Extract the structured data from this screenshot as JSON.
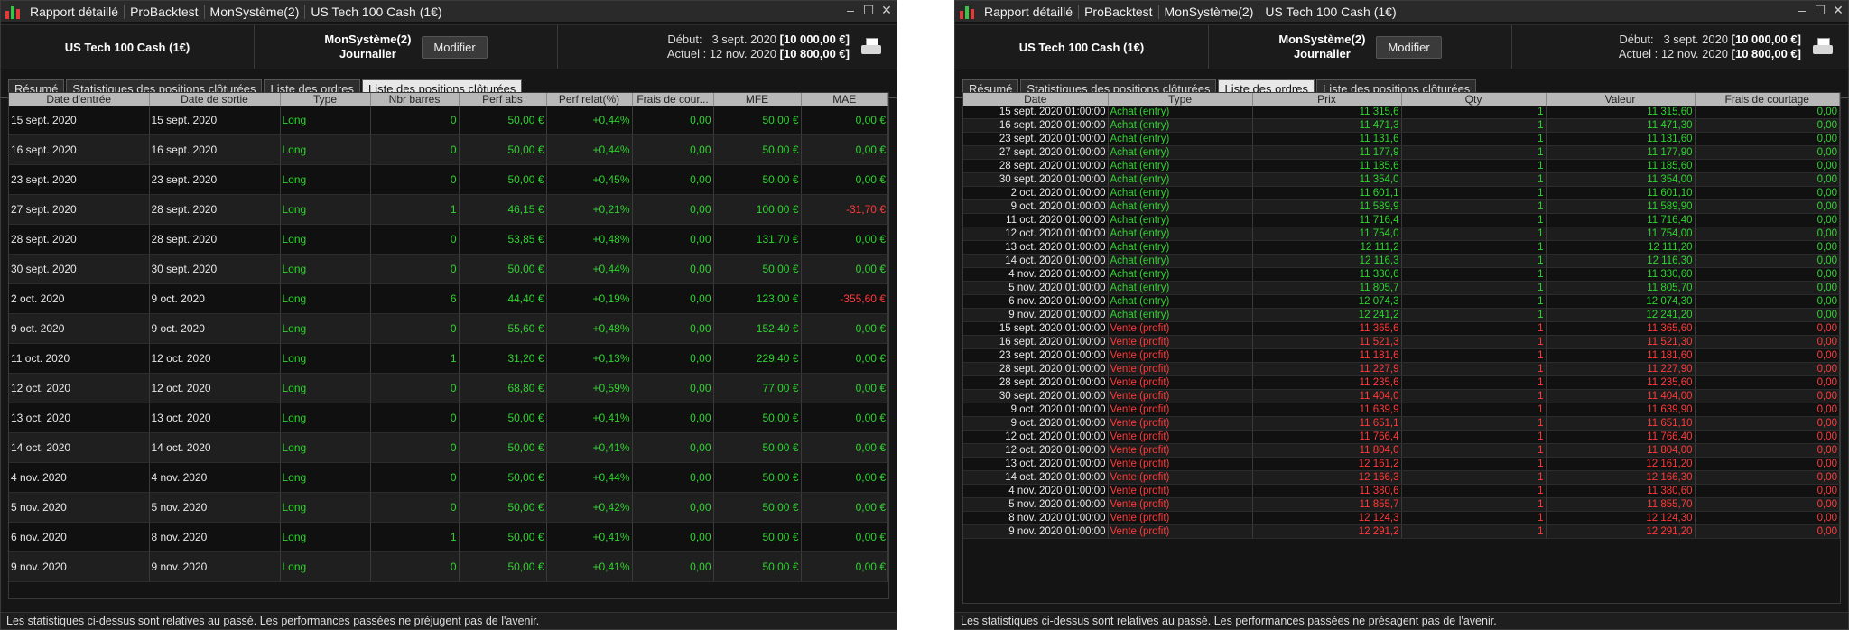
{
  "left": {
    "title_segments": [
      "Rapport détaillé",
      "ProBacktest",
      "MonSystème(2)",
      "US Tech 100 Cash (1€)"
    ],
    "instrument": "US Tech 100 Cash (1€)",
    "system_name": "MonSystème(2)",
    "timeframe": "Journalier",
    "modify_label": "Modifier",
    "start_label": "Début:",
    "start_date": "3 sept. 2020",
    "start_value": "[10 000,00 €]",
    "current_label": "Actuel :",
    "current_date": "12 nov. 2020",
    "current_value": "[10 800,00 €]",
    "tabs": [
      "Résumé",
      "Statistiques des positions clôturées",
      "Liste des ordres",
      "Liste des positions clôturées"
    ],
    "active_tab": 3,
    "columns": [
      "Date d'entrée",
      "Date de sortie",
      "Type",
      "Nbr barres",
      "Perf abs",
      "Perf relat(%)",
      "Frais de cour...",
      "MFE",
      "MAE"
    ],
    "rows": [
      [
        "15 sept. 2020",
        "15 sept. 2020",
        "Long",
        "0",
        "50,00 €",
        "+0,44%",
        "0,00",
        "50,00 €",
        "0,00 €"
      ],
      [
        "16 sept. 2020",
        "16 sept. 2020",
        "Long",
        "0",
        "50,00 €",
        "+0,44%",
        "0,00",
        "50,00 €",
        "0,00 €"
      ],
      [
        "23 sept. 2020",
        "23 sept. 2020",
        "Long",
        "0",
        "50,00 €",
        "+0,45%",
        "0,00",
        "50,00 €",
        "0,00 €"
      ],
      [
        "27 sept. 2020",
        "28 sept. 2020",
        "Long",
        "1",
        "46,15 €",
        "+0,21%",
        "0,00",
        "100,00 €",
        "-31,70 €"
      ],
      [
        "28 sept. 2020",
        "28 sept. 2020",
        "Long",
        "0",
        "53,85 €",
        "+0,48%",
        "0,00",
        "131,70 €",
        "0,00 €"
      ],
      [
        "30 sept. 2020",
        "30 sept. 2020",
        "Long",
        "0",
        "50,00 €",
        "+0,44%",
        "0,00",
        "50,00 €",
        "0,00 €"
      ],
      [
        "2 oct. 2020",
        "9 oct. 2020",
        "Long",
        "6",
        "44,40 €",
        "+0,19%",
        "0,00",
        "123,00 €",
        "-355,60 €"
      ],
      [
        "9 oct. 2020",
        "9 oct. 2020",
        "Long",
        "0",
        "55,60 €",
        "+0,48%",
        "0,00",
        "152,40 €",
        "0,00 €"
      ],
      [
        "11 oct. 2020",
        "12 oct. 2020",
        "Long",
        "1",
        "31,20 €",
        "+0,13%",
        "0,00",
        "229,40 €",
        "0,00 €"
      ],
      [
        "12 oct. 2020",
        "12 oct. 2020",
        "Long",
        "0",
        "68,80 €",
        "+0,59%",
        "0,00",
        "77,00 €",
        "0,00 €"
      ],
      [
        "13 oct. 2020",
        "13 oct. 2020",
        "Long",
        "0",
        "50,00 €",
        "+0,41%",
        "0,00",
        "50,00 €",
        "0,00 €"
      ],
      [
        "14 oct. 2020",
        "14 oct. 2020",
        "Long",
        "0",
        "50,00 €",
        "+0,41%",
        "0,00",
        "50,00 €",
        "0,00 €"
      ],
      [
        "4 nov. 2020",
        "4 nov. 2020",
        "Long",
        "0",
        "50,00 €",
        "+0,44%",
        "0,00",
        "50,00 €",
        "0,00 €"
      ],
      [
        "5 nov. 2020",
        "5 nov. 2020",
        "Long",
        "0",
        "50,00 €",
        "+0,42%",
        "0,00",
        "50,00 €",
        "0,00 €"
      ],
      [
        "6 nov. 2020",
        "8 nov. 2020",
        "Long",
        "1",
        "50,00 €",
        "+0,41%",
        "0,00",
        "50,00 €",
        "0,00 €"
      ],
      [
        "9 nov. 2020",
        "9 nov. 2020",
        "Long",
        "0",
        "50,00 €",
        "+0,41%",
        "0,00",
        "50,00 €",
        "0,00 €"
      ]
    ],
    "footer": "Les statistiques ci-dessus sont relatives au passé. Les performances passées ne préjugent pas de l'avenir."
  },
  "right": {
    "title_segments": [
      "Rapport détaillé",
      "ProBacktest",
      "MonSystème(2)",
      "US Tech 100 Cash (1€)"
    ],
    "instrument": "US Tech 100 Cash (1€)",
    "system_name": "MonSystème(2)",
    "timeframe": "Journalier",
    "modify_label": "Modifier",
    "start_label": "Début:",
    "start_date": "3 sept. 2020",
    "start_value": "[10 000,00 €]",
    "current_label": "Actuel :",
    "current_date": "12 nov. 2020",
    "current_value": "[10 800,00 €]",
    "tabs": [
      "Résumé",
      "Statistiques des positions clôturées",
      "Liste des ordres",
      "Liste des positions clôturées"
    ],
    "active_tab": 2,
    "columns": [
      "Date",
      "Type",
      "Prix",
      "Qty",
      "Valeur",
      "Frais de courtage"
    ],
    "rows": [
      [
        "15 sept. 2020 01:00:00",
        "Achat (entry)",
        "11 315,6",
        "1",
        "11 315,60",
        "0,00"
      ],
      [
        "16 sept. 2020 01:00:00",
        "Achat (entry)",
        "11 471,3",
        "1",
        "11 471,30",
        "0,00"
      ],
      [
        "23 sept. 2020 01:00:00",
        "Achat (entry)",
        "11 131,6",
        "1",
        "11 131,60",
        "0,00"
      ],
      [
        "27 sept. 2020 01:00:00",
        "Achat (entry)",
        "11 177,9",
        "1",
        "11 177,90",
        "0,00"
      ],
      [
        "28 sept. 2020 01:00:00",
        "Achat (entry)",
        "11 185,6",
        "1",
        "11 185,60",
        "0,00"
      ],
      [
        "30 sept. 2020 01:00:00",
        "Achat (entry)",
        "11 354,0",
        "1",
        "11 354,00",
        "0,00"
      ],
      [
        "2 oct. 2020 01:00:00",
        "Achat (entry)",
        "11 601,1",
        "1",
        "11 601,10",
        "0,00"
      ],
      [
        "9 oct. 2020 01:00:00",
        "Achat (entry)",
        "11 589,9",
        "1",
        "11 589,90",
        "0,00"
      ],
      [
        "11 oct. 2020 01:00:00",
        "Achat (entry)",
        "11 716,4",
        "1",
        "11 716,40",
        "0,00"
      ],
      [
        "12 oct. 2020 01:00:00",
        "Achat (entry)",
        "11 754,0",
        "1",
        "11 754,00",
        "0,00"
      ],
      [
        "13 oct. 2020 01:00:00",
        "Achat (entry)",
        "12 111,2",
        "1",
        "12 111,20",
        "0,00"
      ],
      [
        "14 oct. 2020 01:00:00",
        "Achat (entry)",
        "12 116,3",
        "1",
        "12 116,30",
        "0,00"
      ],
      [
        "4 nov. 2020 01:00:00",
        "Achat (entry)",
        "11 330,6",
        "1",
        "11 330,60",
        "0,00"
      ],
      [
        "5 nov. 2020 01:00:00",
        "Achat (entry)",
        "11 805,7",
        "1",
        "11 805,70",
        "0,00"
      ],
      [
        "6 nov. 2020 01:00:00",
        "Achat (entry)",
        "12 074,3",
        "1",
        "12 074,30",
        "0,00"
      ],
      [
        "9 nov. 2020 01:00:00",
        "Achat (entry)",
        "12 241,2",
        "1",
        "12 241,20",
        "0,00"
      ],
      [
        "15 sept. 2020 01:00:00",
        "Vente (profit)",
        "11 365,6",
        "1",
        "11 365,60",
        "0,00"
      ],
      [
        "16 sept. 2020 01:00:00",
        "Vente (profit)",
        "11 521,3",
        "1",
        "11 521,30",
        "0,00"
      ],
      [
        "23 sept. 2020 01:00:00",
        "Vente (profit)",
        "11 181,6",
        "1",
        "11 181,60",
        "0,00"
      ],
      [
        "28 sept. 2020 01:00:00",
        "Vente (profit)",
        "11 227,9",
        "1",
        "11 227,90",
        "0,00"
      ],
      [
        "28 sept. 2020 01:00:00",
        "Vente (profit)",
        "11 235,6",
        "1",
        "11 235,60",
        "0,00"
      ],
      [
        "30 sept. 2020 01:00:00",
        "Vente (profit)",
        "11 404,0",
        "1",
        "11 404,00",
        "0,00"
      ],
      [
        "9 oct. 2020 01:00:00",
        "Vente (profit)",
        "11 639,9",
        "1",
        "11 639,90",
        "0,00"
      ],
      [
        "9 oct. 2020 01:00:00",
        "Vente (profit)",
        "11 651,1",
        "1",
        "11 651,10",
        "0,00"
      ],
      [
        "12 oct. 2020 01:00:00",
        "Vente (profit)",
        "11 766,4",
        "1",
        "11 766,40",
        "0,00"
      ],
      [
        "12 oct. 2020 01:00:00",
        "Vente (profit)",
        "11 804,0",
        "1",
        "11 804,00",
        "0,00"
      ],
      [
        "13 oct. 2020 01:00:00",
        "Vente (profit)",
        "12 161,2",
        "1",
        "12 161,20",
        "0,00"
      ],
      [
        "14 oct. 2020 01:00:00",
        "Vente (profit)",
        "12 166,3",
        "1",
        "12 166,30",
        "0,00"
      ],
      [
        "4 nov. 2020 01:00:00",
        "Vente (profit)",
        "11 380,6",
        "1",
        "11 380,60",
        "0,00"
      ],
      [
        "5 nov. 2020 01:00:00",
        "Vente (profit)",
        "11 855,7",
        "1",
        "11 855,70",
        "0,00"
      ],
      [
        "8 nov. 2020 01:00:00",
        "Vente (profit)",
        "12 124,3",
        "1",
        "12 124,30",
        "0,00"
      ],
      [
        "9 nov. 2020 01:00:00",
        "Vente (profit)",
        "12 291,2",
        "1",
        "12 291,20",
        "0,00"
      ]
    ],
    "footer": "Les statistiques ci-dessus sont relatives au passé. Les performances passées ne présagent pas de l'avenir."
  },
  "colors": {
    "positive": "#2fd42f",
    "negative": "#ff3a3a",
    "background": "#161616",
    "header": "#b8b8b8"
  }
}
